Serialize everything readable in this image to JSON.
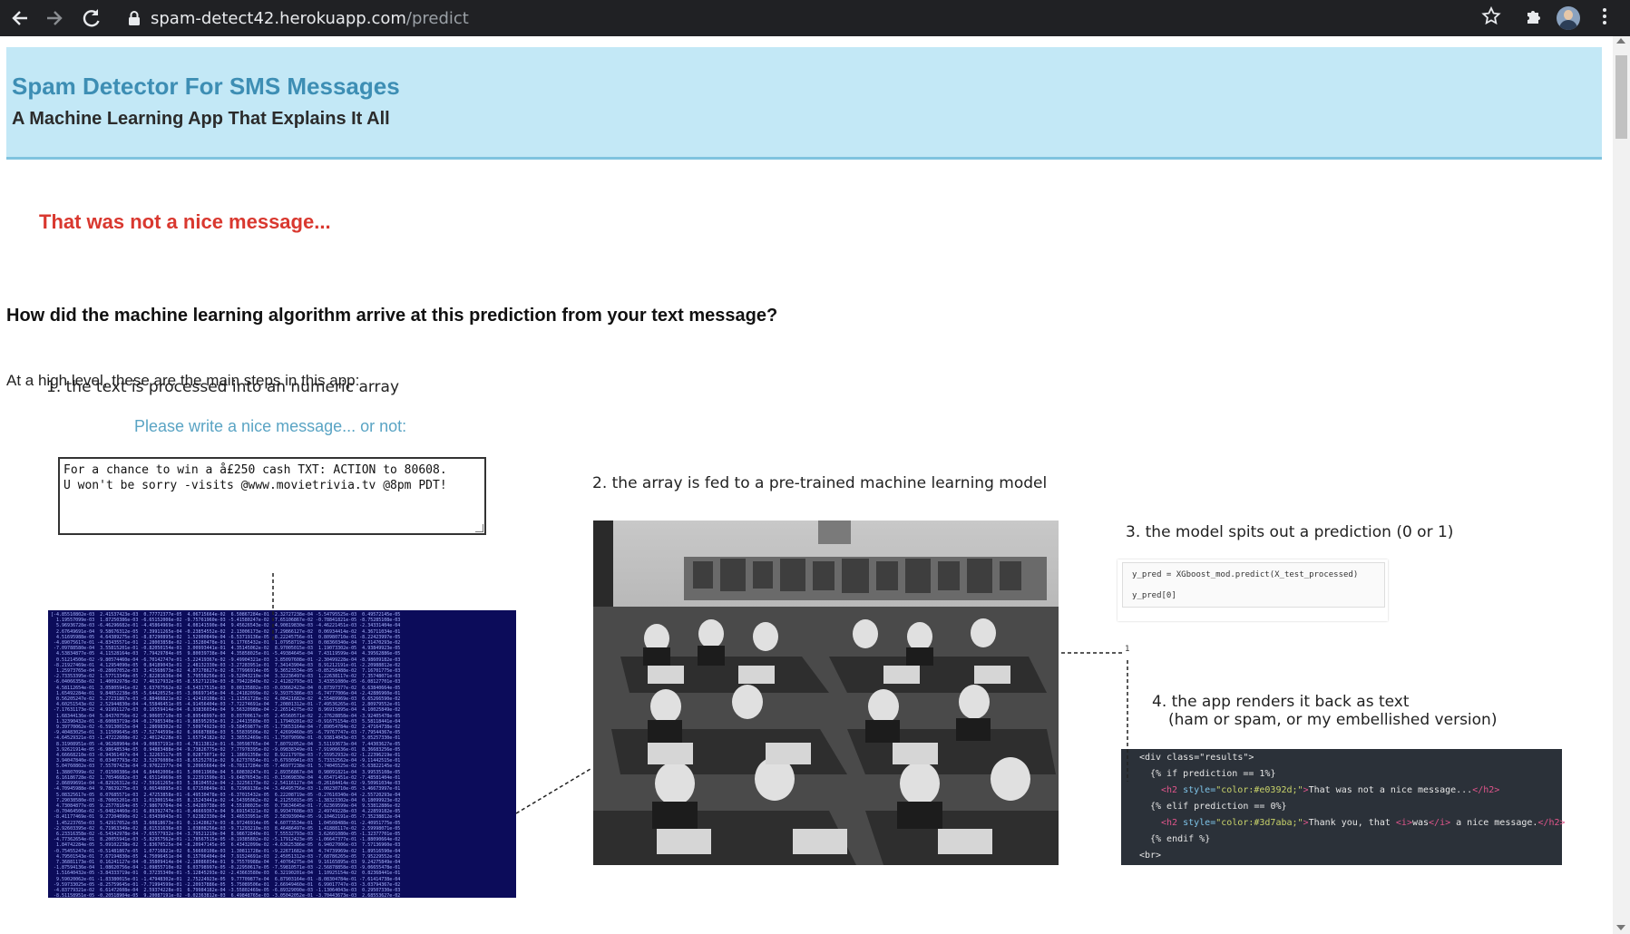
{
  "browser": {
    "url_host": "spam-detect42.herokuapp.com",
    "url_path": "/predict",
    "back_icon": "arrow-left",
    "forward_icon": "arrow-right",
    "reload_icon": "reload",
    "lock_icon": "lock",
    "star_icon": "star",
    "extensions_icon": "puzzle",
    "menu_icon": "vertical-dots"
  },
  "header": {
    "title": "Spam Detector For SMS Messages",
    "subtitle": "A Machine Learning App That Explains It All"
  },
  "result": {
    "text": "That was not a nice message...",
    "color": "#d9382f"
  },
  "explanation": {
    "question": "How did the machine learning algorithm arrive at this prediction from your text message?",
    "intro": "At a high level, these are the main steps in this app:",
    "step1": "1. the text is processed into an numeric array",
    "step2": "2. the array is fed to a pre-trained machine learning model",
    "step3": "3. the model spits out a prediction (0 or 1)",
    "step4_line1": "4. the app renders it back as text",
    "step4_line2": "(ham or spam, or my embellished version)"
  },
  "form": {
    "prompt": "Please write a nice message... or not:",
    "message": "For a chance to win a å£250 cash TXT: ACTION to 80608.\nU won't be sorry -visits @www.movietrivia.tv @8pm PDT!"
  },
  "code_predict": {
    "line1": "y_pred = XGboost_mod.predict(X_test_processed)",
    "line2": "y_pred[0]",
    "output": "1"
  },
  "code_template": {
    "line1": "<div class=\"results\">",
    "line2": "{% if prediction == 1%}",
    "line3": "<h2 style=\"color:#e0392d;\">That was not a nice message...</h2>",
    "line4": "{% elif prediction == 0%}",
    "line5": "<h2 style=\"color:#3d7aba;\">Thank you, that <i>was</i> a nice message.</h2>",
    "line6": "{% endif %}",
    "line7": "<br>"
  },
  "colors": {
    "header_bg": "#c3e8f6",
    "title_blue": "#3d8eb4",
    "prompt_blue": "#5aa4c4",
    "matrix_bg": "#0c0c5a"
  }
}
